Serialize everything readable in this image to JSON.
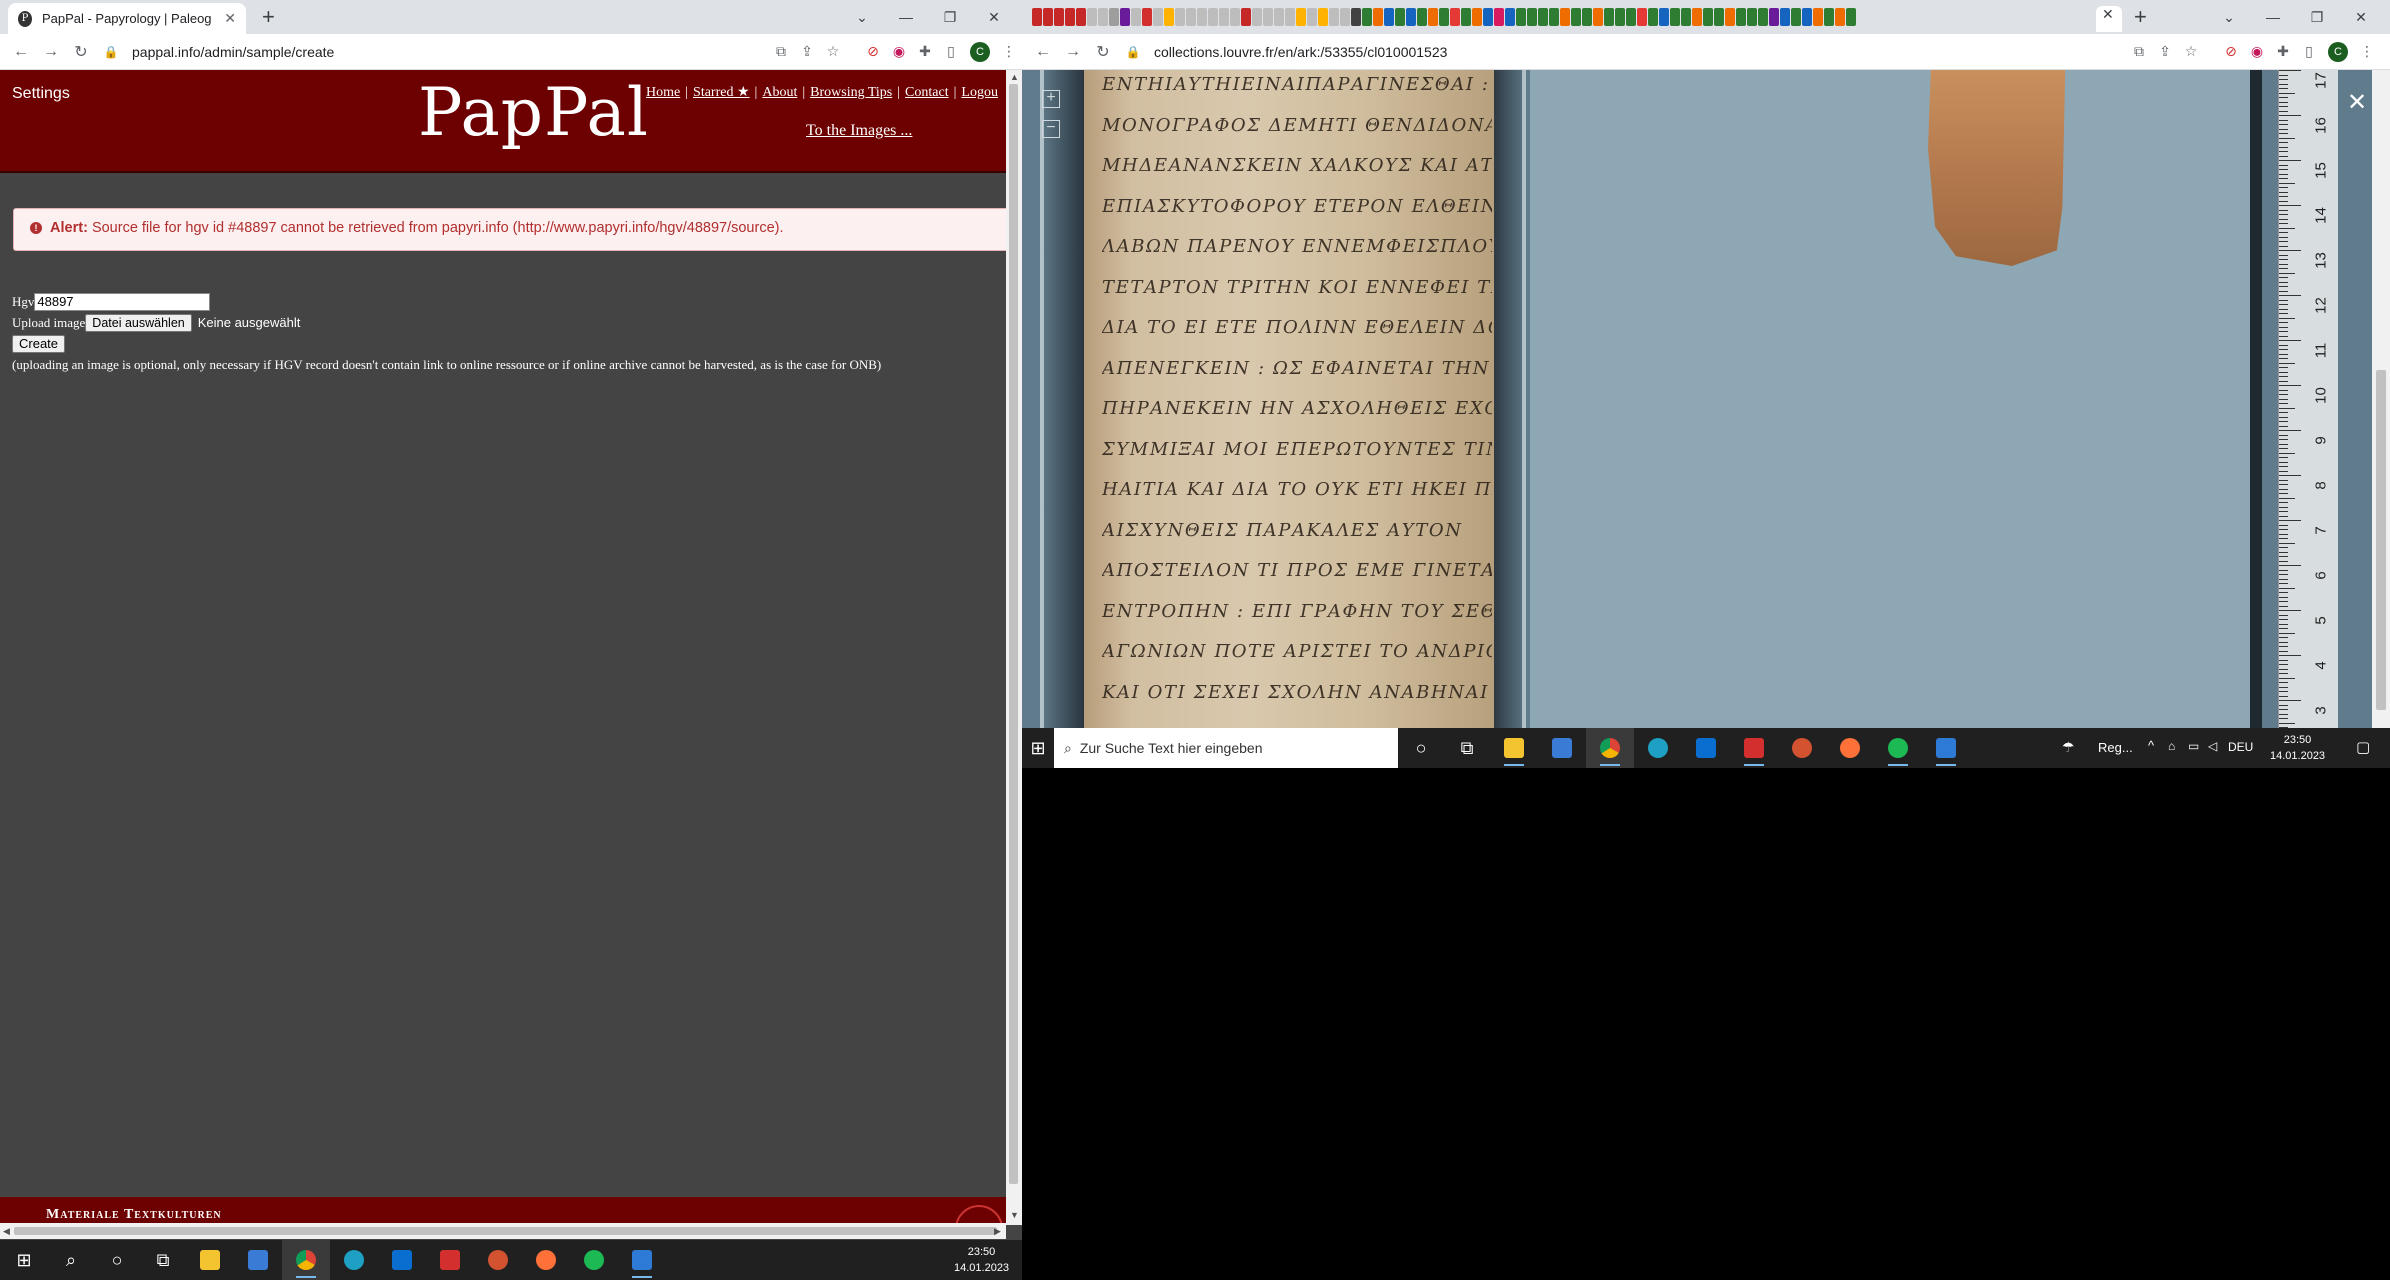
{
  "left": {
    "tab_title": "PapPal - Papyrology | Paleograph",
    "url": "pappal.info/admin/sample/create",
    "site": {
      "settings": "Settings",
      "logo": "PapPal",
      "nav": [
        "Home",
        "Starred ★",
        "About",
        "Browsing Tips",
        "Contact",
        "Logou"
      ],
      "to_images": "To the Images ...",
      "alert_label": "Alert:",
      "alert_text": "Source file for hgv id #48897 cannot be retrieved from papyri.info (http://www.papyri.info/hgv/48897/source).",
      "form": {
        "hgv_label": "Hgv",
        "hgv_value": "48897",
        "upload_label": "Upload image",
        "file_button": "Datei auswählen",
        "file_status": "Keine ausgewählt",
        "create_button": "Create",
        "note": "(uploading an image is optional, only necessary if HGV record doesn't contain link to online ressource or if online archive cannot be harvested, as is the case for ONB)"
      },
      "footer_text": "Materiale Textkulturen"
    },
    "taskbar": {
      "time": "23:50",
      "date": "14.01.2023"
    }
  },
  "right": {
    "url": "collections.louvre.fr/en/ark:/53355/cl010001523",
    "papyrus_lines": [
      "ΕΝΤΗΙΑΥΤΗΙΕΙΝΑΙΠΑΡΑΓΙΝΕΣΘΑΙ :",
      "ΜΟΝΟΓΡΑΦΟΣ ΔΕΜΗΤΙ ΘΕΝΔΙΔΟΝΑΙ ΓΡΑΦΕΙΝ",
      "ΜΗΔΕΑΝΑΝΣΚΕΙΝ ΧΑΛΚΟΥΣ ΚΑΙ ΑΤΕΛΗ",
      "ΕΠΙΑΣΚΥΤΟΦΟΡΟΥ ΕΤΕΡΟΝ ΕΛΘΕΙΝ ΟΠΩΣ",
      "ΛΑΒΩΝ ΠΑΡΕΝΟΥ ΕΝΝΕΜΦΕΙΣΠΛΟΥ",
      "ΤΕΤΑΡΤΟΝ ΤΡΙΤΗΝ ΚΟΙ ΕΝΝΕΦΕΙ ΤΡΗΝ",
      "ΔΙΑ ΤΟ ΕΙ ΕΤΕ ΠΟΛΙΝΝ ΕΘΕΛΕΙΝ ΔΟΥΝΑΙ",
      "ΑΠΕΝΕΓΚΕΙΝ : ΩΣ ΕΦΑΙΝΕΤΑΙ ΤΗΝ",
      "ΠΗΡΑΝΕΚΕΙΝ ΗΝ ΑΣΧΟΛΗΘΕΙΣ ΕΧΟΥΝΤΑ",
      "ΣΥΜΜΙΞΑΙ ΜΟΙ ΕΠΕΡΩΤΟΥΝΤΕΣ ΤΙΝ ΑΥΤΗ",
      "ΗΑΙΤΙΑ ΚΑΙ ΔΙΑ ΤΟ ΟΥΚ ΕΤΙ ΗΚΕΙ ΠΡΟΣ ΕΜΕ",
      "ΑΙΣΧΥΝΘΕΙΣ ΠΑΡΑΚΑΛΕΣ ΑΥΤΟΝ",
      "ΑΠΟΣΤΕΙΛΟΝ ΤΙ ΠΡΟΣ ΕΜΕ ΓΙΝΕΤΑΙ ΓΑΡ",
      "ΕΝΤΡΟΠΗΝ : ΕΠΙ ΓΡΑΦΗΝ ΤΟΥ ΣΕΘΕΟΥΣ",
      "ΑΓΩΝΙΩΝ ΠΟΤΕ ΑΡΙΣΤΕΙ ΤΟ ΑΝΔΡΙΟΝ",
      "ΚΑΙ ΟΤΙ ΣΕΧΕΙ ΣΧΟΛΗΝ ΑΝΑΒΗΝΑΙ ΠΡΟΣ ΥΜΑΣ"
    ],
    "ruler_numbers": [
      "17",
      "16",
      "15",
      "14",
      "13",
      "12",
      "11",
      "10",
      "9",
      "8",
      "7",
      "6",
      "5",
      "4",
      "3"
    ],
    "taskbar": {
      "search_placeholder": "Zur Suche Text hier eingeben",
      "weather": "Reg...",
      "lang": "DEU",
      "time": "23:50",
      "date": "14.01.2023"
    }
  }
}
